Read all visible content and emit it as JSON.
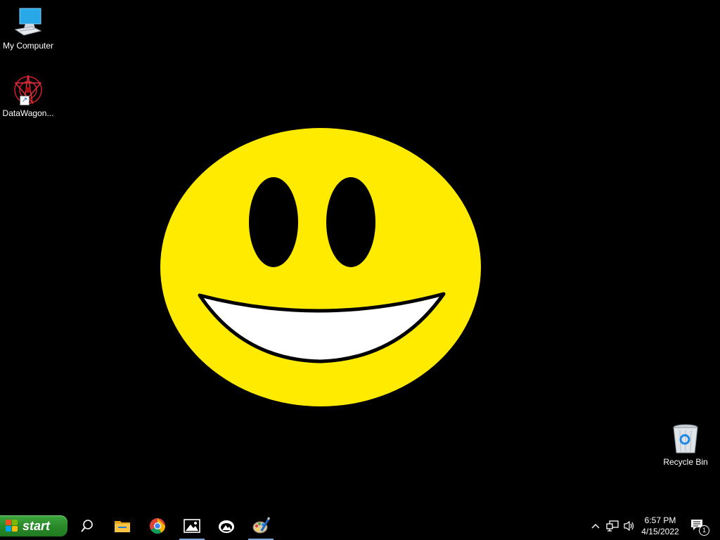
{
  "desktop": {
    "icons": [
      {
        "label": "My Computer",
        "icon": "computer-icon"
      },
      {
        "label": "DataWagon...",
        "icon": "datawagon-icon"
      },
      {
        "label": "Recycle Bin",
        "icon": "recycle-bin-icon"
      }
    ],
    "wallpaper": {
      "face_color": "#FFEB00",
      "mouth_color": "#FFFFFF",
      "background": "#000000"
    }
  },
  "taskbar": {
    "start_label": "start",
    "apps": [
      {
        "name": "search",
        "icon": "search-icon"
      },
      {
        "name": "file-explorer",
        "icon": "folder-icon"
      },
      {
        "name": "chrome",
        "icon": "chrome-icon"
      },
      {
        "name": "photos",
        "icon": "photos-icon",
        "active": true
      },
      {
        "name": "paint-3d",
        "icon": "paint3d-icon"
      },
      {
        "name": "paint",
        "icon": "paint-icon",
        "active": true
      }
    ],
    "tray": {
      "time": "6:57 PM",
      "date": "4/15/2022",
      "notification_count": "1"
    }
  }
}
